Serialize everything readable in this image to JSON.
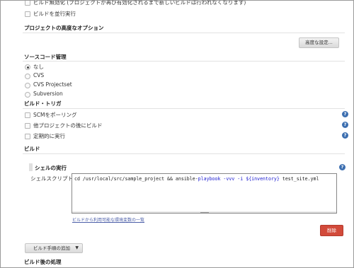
{
  "top_options": [
    {
      "label": "ビルド無効化 (プロジェクトが再び有効化されるまで新しいビルドは行われなくなります)"
    },
    {
      "label": "ビルドを並行実行"
    }
  ],
  "advanced": {
    "title": "プロジェクトの高度なオプション",
    "button_label": "高度な設定..."
  },
  "scm": {
    "title": "ソースコード管理",
    "options": [
      {
        "label": "なし",
        "checked": true
      },
      {
        "label": "CVS",
        "checked": false
      },
      {
        "label": "CVS Projectset",
        "checked": false
      },
      {
        "label": "Subversion",
        "checked": false
      }
    ]
  },
  "triggers": {
    "title": "ビルド・トリガ",
    "options": [
      {
        "label": "SCMをポーリング"
      },
      {
        "label": "他プロジェクトの後にビルド"
      },
      {
        "label": "定期的に実行"
      }
    ]
  },
  "build": {
    "title": "ビルド",
    "step_title": "シェルの実行",
    "script_label": "シェルスクリプト",
    "command": {
      "prefix": "cd /usr/local/src/sample_project && ansible-",
      "kw1": "playbook",
      "mid1": " ",
      "kw2": "-vvv",
      "mid2": " ",
      "kw3": "-i",
      "mid3": " ",
      "kw4": "${inventory}",
      "suffix": " test_site.yml"
    },
    "env_link": "ビルドから利用可能な環境変数の一覧",
    "delete_label": "削除",
    "add_step_label": "ビルド手順の追加"
  },
  "post_build": {
    "title": "ビルド後の処理"
  },
  "colors": {
    "delete_button": "#d24a3a",
    "help_icon": "#3d6fb0",
    "keyword": "#1b1bd0"
  }
}
